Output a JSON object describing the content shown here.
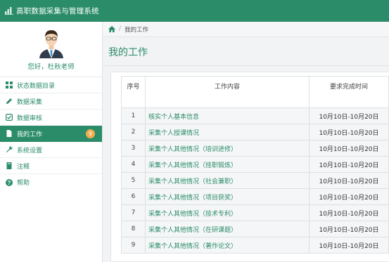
{
  "app": {
    "title": "高职数据采集与管理系统"
  },
  "sidebar": {
    "greeting": "您好，杜秋老师",
    "items": [
      {
        "label": "状态数据目录",
        "icon": "grid-icon"
      },
      {
        "label": "数据采集",
        "icon": "pencil-icon"
      },
      {
        "label": "数据审核",
        "icon": "check-square-icon"
      },
      {
        "label": "我的工作",
        "icon": "file-icon",
        "badge": "9",
        "active": true
      },
      {
        "label": "系统设置",
        "icon": "wrench-icon"
      },
      {
        "label": "注释",
        "icon": "book-icon"
      },
      {
        "label": "帮助",
        "icon": "question-circle-icon"
      }
    ]
  },
  "breadcrumb": {
    "current": "我的工作"
  },
  "page": {
    "title": "我的工作"
  },
  "table": {
    "headers": [
      "序号",
      "工作内容",
      "要求完成时间"
    ],
    "rows": [
      {
        "idx": "1",
        "task": "核实个人基本信息",
        "deadline": "10月10日-10月20日"
      },
      {
        "idx": "2",
        "task": "采集个人授课情况",
        "deadline": "10月10日-10月20日"
      },
      {
        "idx": "3",
        "task": "采集个人其他情况（培训进修）",
        "deadline": "10月10日-10月20日"
      },
      {
        "idx": "4",
        "task": "采集个人其他情况（挂职锻炼）",
        "deadline": "10月10日-10月20日"
      },
      {
        "idx": "5",
        "task": "采集个人其他情况（社会兼职）",
        "deadline": "10月10日-10月20日"
      },
      {
        "idx": "6",
        "task": "采集个人其他情况（项目获奖）",
        "deadline": "10月10日-10月20日"
      },
      {
        "idx": "7",
        "task": "采集个人其他情况（技术专利）",
        "deadline": "10月10日-10月20日"
      },
      {
        "idx": "8",
        "task": "采集个人其他情况（在研课题）",
        "deadline": "10月10日-10月20日"
      },
      {
        "idx": "9",
        "task": "采集个人其他情况（著作论文）",
        "deadline": "10月10日-10月20日"
      }
    ]
  },
  "colors": {
    "primary": "#2a8c68",
    "badge": "#f0ad4e"
  }
}
